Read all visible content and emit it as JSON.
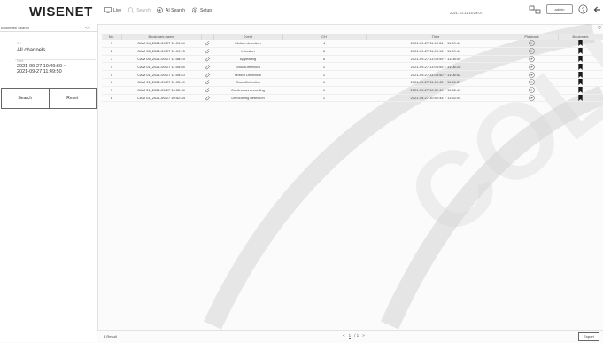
{
  "header": {
    "logo": "WISENET",
    "menu": [
      {
        "label": "Live",
        "icon": "monitor-icon",
        "state": "normal"
      },
      {
        "label": "Search",
        "icon": "search-icon",
        "state": "disabled"
      },
      {
        "label": "AI Search",
        "icon": "ai-search-icon",
        "state": "normal"
      },
      {
        "label": "Setup",
        "icon": "gear-icon",
        "state": "normal"
      }
    ],
    "datetime": "2021-10-11 14:29:07",
    "user": "admin"
  },
  "sidebar": {
    "title": "Bookmark Search",
    "collapse": "<<",
    "channel_label": "CH",
    "channels": "All channels",
    "date_label": "Date",
    "date_range": [
      "2021-09-27 10:49:50 ~",
      "2021-09-27 11:49:50"
    ],
    "search_button": "Search",
    "reset_button": "Reset"
  },
  "table": {
    "columns": [
      "No.",
      "Bookmark name",
      "",
      "Event",
      "CH",
      "Time",
      "Playback",
      "Bookmark"
    ],
    "rows": [
      {
        "no": "1",
        "name": "CAM 04_2021-09-27 11:09:34",
        "event": "Motion detection",
        "ch": "4",
        "time": "2021-09-27 11:09:34 ~ 11:09:44"
      },
      {
        "no": "2",
        "name": "CAM 05_2021-09-27 11:09:13",
        "event": "Intrusion",
        "ch": "5",
        "time": "2021-09-27 11:09:13 ~ 11:09:44"
      },
      {
        "no": "3",
        "name": "CAM 05_2021-09-27 11:08:49",
        "event": "Appearing",
        "ch": "5",
        "time": "2021-09-27 11:08:49 ~ 11:08:49"
      },
      {
        "no": "4",
        "name": "CAM 01_2021-09-27 11:05:55",
        "event": "ShockDetection",
        "ch": "1",
        "time": "2021-09-27 11:05:55 ~ 11:06:26"
      },
      {
        "no": "5",
        "name": "CAM 01_2021-09-27 11:05:40",
        "event": "Motion Detection",
        "ch": "1",
        "time": "2021-09-27 11:05:40 ~ 11:06:52"
      },
      {
        "no": "6",
        "name": "CAM 01_2021-09-27 11:05:40",
        "event": "ShockDetection",
        "ch": "1",
        "time": "2021-09-27 11:05:40 ~ 11:06:39"
      },
      {
        "no": "7",
        "name": "CAM 01_2021-09-27 10:52:49",
        "event": "Continuous recording",
        "ch": "1",
        "time": "2021-09-27 10:52:49 ~ 11:52:49"
      },
      {
        "no": "8",
        "name": "CAM 01_2021-09-27 10:52:44",
        "event": "Defocusing detection",
        "ch": "1",
        "time": "2021-09-27 10:52:44 ~ 11:52:44"
      }
    ]
  },
  "footer": {
    "result": "8 Result",
    "pager": [
      "<",
      "1",
      "/ 1",
      ">"
    ],
    "export": "Export"
  },
  "watermark": "COLLECTION"
}
